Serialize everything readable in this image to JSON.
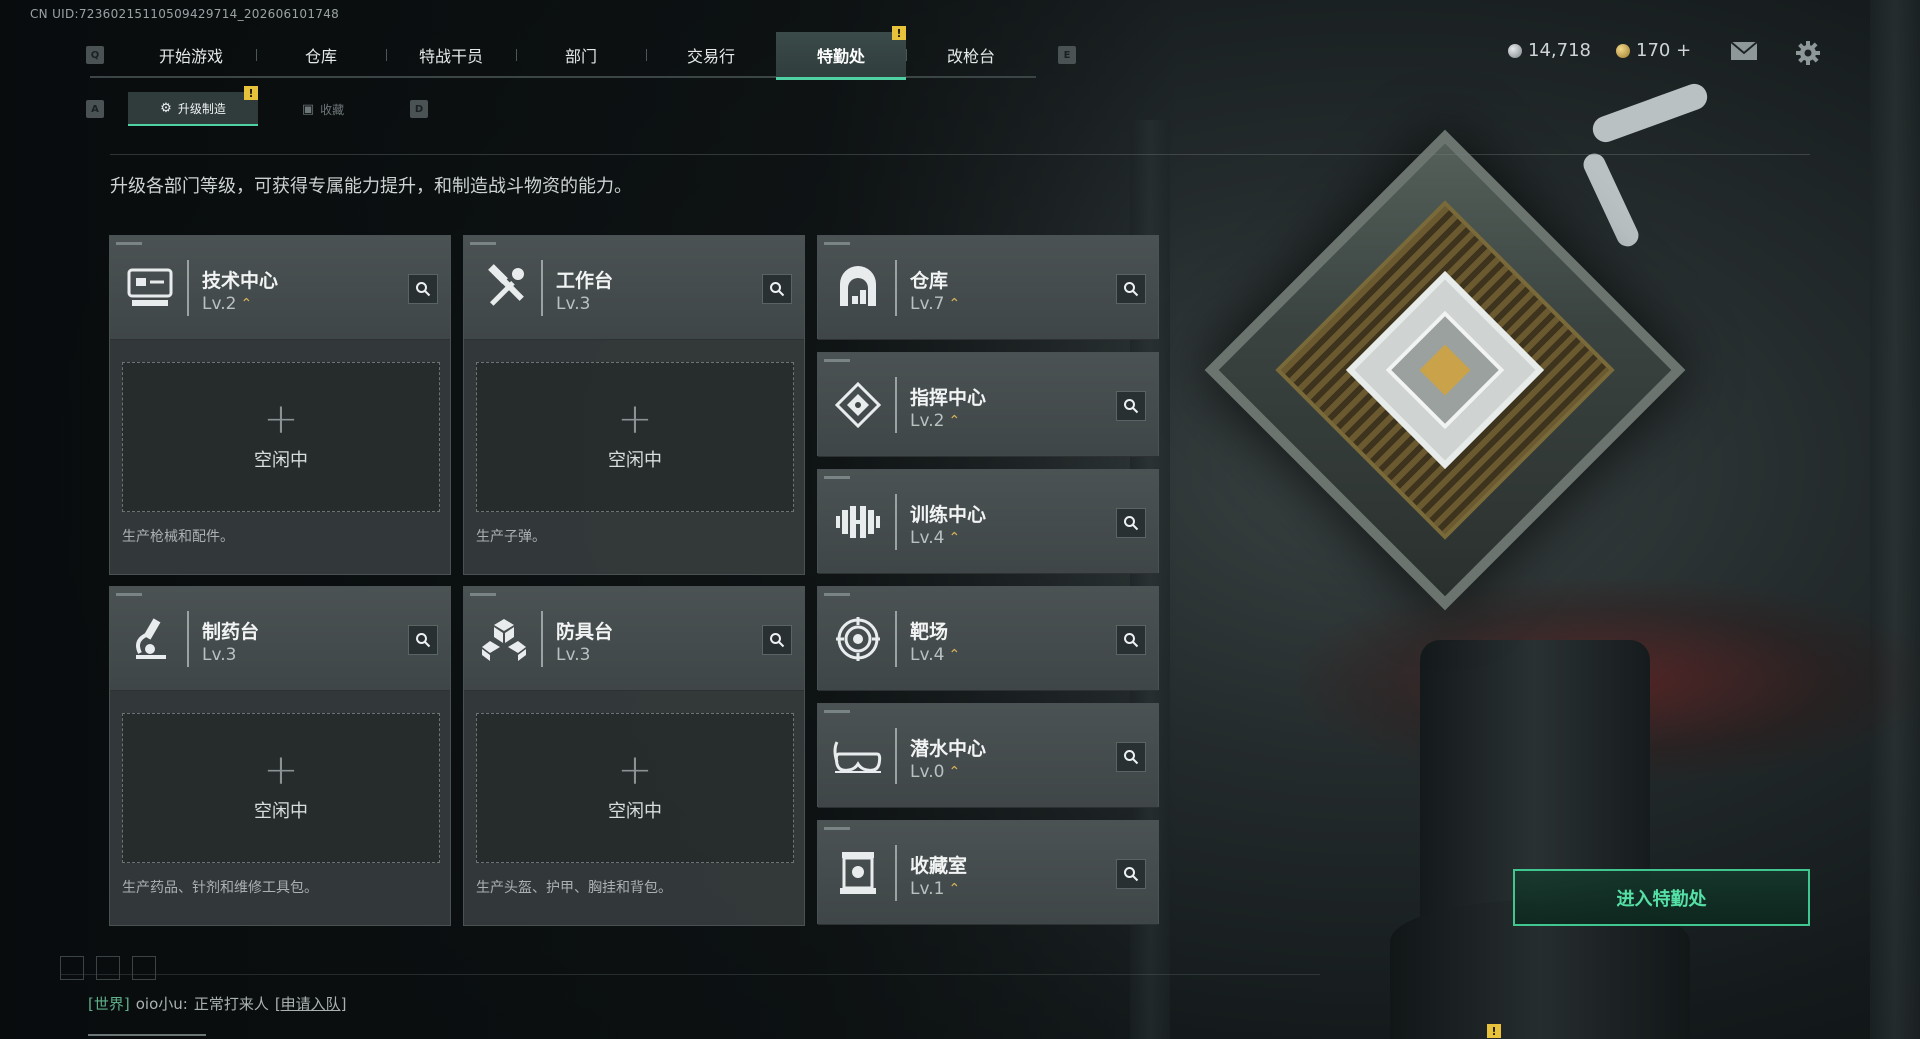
{
  "uid_text": "CN UID:7236021511050942971​4_202606101748",
  "nav": {
    "key_left": "Q",
    "key_right": "E",
    "tabs": [
      "开始游戏",
      "仓库",
      "特战干员",
      "部门",
      "交易行",
      "特勤处",
      "改枪台"
    ],
    "active_tab": "特勤处",
    "alert_mark": "!"
  },
  "currency": {
    "silver": "14,718",
    "gold": "170 +"
  },
  "subnav": {
    "key_left": "A",
    "key_right": "D",
    "upgrade_label": "升级制造",
    "collect_label": "收藏",
    "alert_mark": "!"
  },
  "description": "升级各部门等级，可获得专属能力提升，和制造战斗物资的能力。",
  "production": {
    "tech_center": {
      "name": "技术中心",
      "level": "Lv.2",
      "idle": "空闲中",
      "plus": "+",
      "produces": "生产枪械和配件。"
    },
    "workbench": {
      "name": "工作台",
      "level": "Lv.3",
      "idle": "空闲中",
      "plus": "+",
      "produces": "生产子弹。"
    },
    "pharmacy": {
      "name": "制药台",
      "level": "Lv.3",
      "idle": "空闲中",
      "plus": "+",
      "produces": "生产药品、针剂和维修工具包。"
    },
    "armor_bench": {
      "name": "防具台",
      "level": "Lv.3",
      "idle": "空闲中",
      "plus": "+",
      "produces": "生产头盔、护甲、胸挂和背包。"
    }
  },
  "departments": [
    {
      "name": "仓库",
      "level": "Lv.7",
      "icon": "warehouse-icon"
    },
    {
      "name": "指挥中心",
      "level": "Lv.2",
      "icon": "command-icon"
    },
    {
      "name": "训练中心",
      "level": "Lv.4",
      "icon": "dumbbell-icon"
    },
    {
      "name": "靶场",
      "level": "Lv.4",
      "icon": "target-icon"
    },
    {
      "name": "潜水中心",
      "level": "Lv.0",
      "icon": "diving-mask-icon"
    },
    {
      "name": "收藏室",
      "level": "Lv.1",
      "icon": "collection-icon"
    }
  ],
  "upgrade_arrow": "⌃",
  "enter_button": "进入特勤处",
  "chat": {
    "channel": "[世界]",
    "user": "oio小u:",
    "message": "正常打来人",
    "action": "[申请入队]"
  },
  "colors": {
    "accent": "#4fd1a4",
    "alert": "#e8c23a",
    "upgrade": "#d6b25a",
    "card": "#3f4647"
  }
}
